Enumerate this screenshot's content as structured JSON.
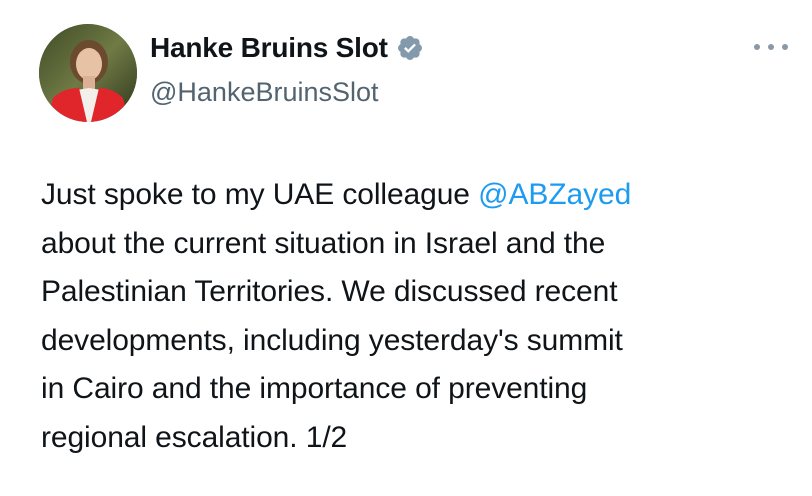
{
  "author": {
    "display_name": "Hanke Bruins Slot",
    "handle": "@HankeBruinsSlot",
    "verified_icon": "verified-badge-icon",
    "avatar_icon": "user-avatar"
  },
  "tweet": {
    "line1_prefix": "Just spoke to my UAE colleague ",
    "mention": "@ABZayed",
    "line2": "about the current situation in Israel and the",
    "line3": "Palestinian Territories. We discussed recent",
    "line4": "developments, including yesterday's summit",
    "line5": "in Cairo and the importance of preventing",
    "line6": "regional escalation. 1/2"
  },
  "menu": {
    "more_icon": "more-options-icon"
  },
  "colors": {
    "text": "#0f1419",
    "secondary": "#536471",
    "link": "#1d9bf0",
    "verified": "#829aab"
  }
}
